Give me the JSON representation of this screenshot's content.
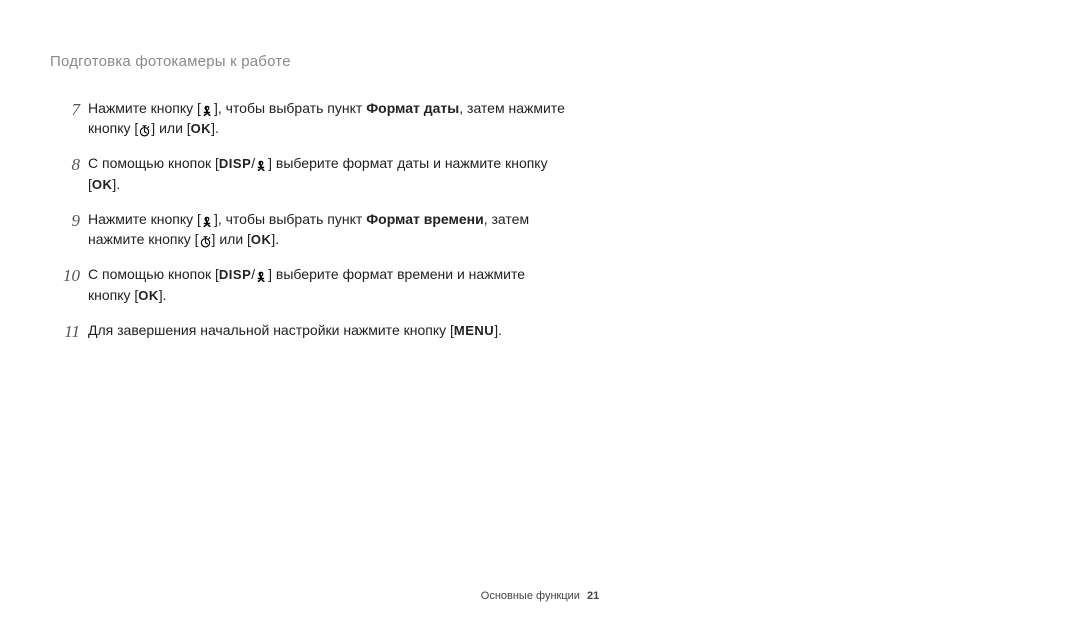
{
  "header": {
    "title": "Подготовка фотокамеры к работе"
  },
  "steps": [
    {
      "num": "7",
      "parts": [
        {
          "t": "Нажмите кнопку ["
        },
        {
          "icon": "macro"
        },
        {
          "t": "], чтобы выбрать пункт "
        },
        {
          "t": "Формат даты",
          "bold": true
        },
        {
          "t": ", затем нажмите кнопку ["
        },
        {
          "icon": "timer"
        },
        {
          "t": "] или ["
        },
        {
          "icon": "ok"
        },
        {
          "t": "]."
        }
      ]
    },
    {
      "num": "8",
      "parts": [
        {
          "t": "С помощью кнопок ["
        },
        {
          "icon": "disp"
        },
        {
          "t": "/"
        },
        {
          "icon": "macro"
        },
        {
          "t": "] выберите формат даты и нажмите кнопку ["
        },
        {
          "icon": "ok"
        },
        {
          "t": "]."
        }
      ]
    },
    {
      "num": "9",
      "parts": [
        {
          "t": "Нажмите кнопку ["
        },
        {
          "icon": "macro"
        },
        {
          "t": "], чтобы выбрать пункт "
        },
        {
          "t": "Формат времени",
          "bold": true
        },
        {
          "t": ", затем нажмите кнопку ["
        },
        {
          "icon": "timer"
        },
        {
          "t": "] или ["
        },
        {
          "icon": "ok"
        },
        {
          "t": "]."
        }
      ]
    },
    {
      "num": "10",
      "parts": [
        {
          "t": "С помощью кнопок ["
        },
        {
          "icon": "disp"
        },
        {
          "t": "/"
        },
        {
          "icon": "macro"
        },
        {
          "t": "] выберите формат времени и нажмите кнопку ["
        },
        {
          "icon": "ok"
        },
        {
          "t": "]."
        }
      ]
    },
    {
      "num": "11",
      "parts": [
        {
          "t": "Для завершения начальной настройки нажмите кнопку ["
        },
        {
          "icon": "menu"
        },
        {
          "t": "]."
        }
      ]
    }
  ],
  "icons": {
    "macro": "<svg class='icon' viewBox='0 0 16 16' width='13' height='13'><path fill='#000' d='M8 1c1.4 0 2.5 1.3 2.5 3 0 1.4-.8 2.7-2 3.4V9h3v2H9.2c.6 1.1 1.8 1.9 3 2.2l-.5 1.8c-1.9-.5-3.5-1.9-4.2-3.7-.7 1.8-2.3 3.2-4.2 3.7L2.8 13c1.2-.3 2.4-1.1 3-2.2H3V9h3V7.4c-1.2-.7-2-2-2-3.4 0-1.7 1.1-3 2.5-3zm0 2c-.4 0-1 .5-1 1.4 0 .9.6 1.6 1 1.6s1-.7 1-1.6c0-.9-.6-1.4-1-1.4z'/></svg>",
    "timer": "<svg class='icon' viewBox='0 0 16 16' width='13' height='13'><circle cx='8' cy='9' r='5.5' fill='none' stroke='#000' stroke-width='1.5'/><path d='M8 5v4l2.5 1.5' fill='none' stroke='#000' stroke-width='1.5' stroke-linecap='round'/><path d='M6 1h4M8 1v2' fill='none' stroke='#000' stroke-width='1.5' stroke-linecap='round'/><path d='M12.5 3.5l1.2-1.2' fill='none' stroke='#000' stroke-width='1.5' stroke-linecap='round'/></svg>",
    "ok": "<span style='font-weight:700;font-family:Arial;font-size:13px;letter-spacing:0.5px;'>OK</span>",
    "disp": "<span style='font-weight:700;font-family:Arial;font-size:13px;letter-spacing:0.5px;'>DISP</span>",
    "menu": "<span style='font-weight:700;font-family:Arial;font-size:13px;letter-spacing:0.5px;'>MENU</span>"
  },
  "footer": {
    "section": "Основные функции",
    "page": "21"
  }
}
